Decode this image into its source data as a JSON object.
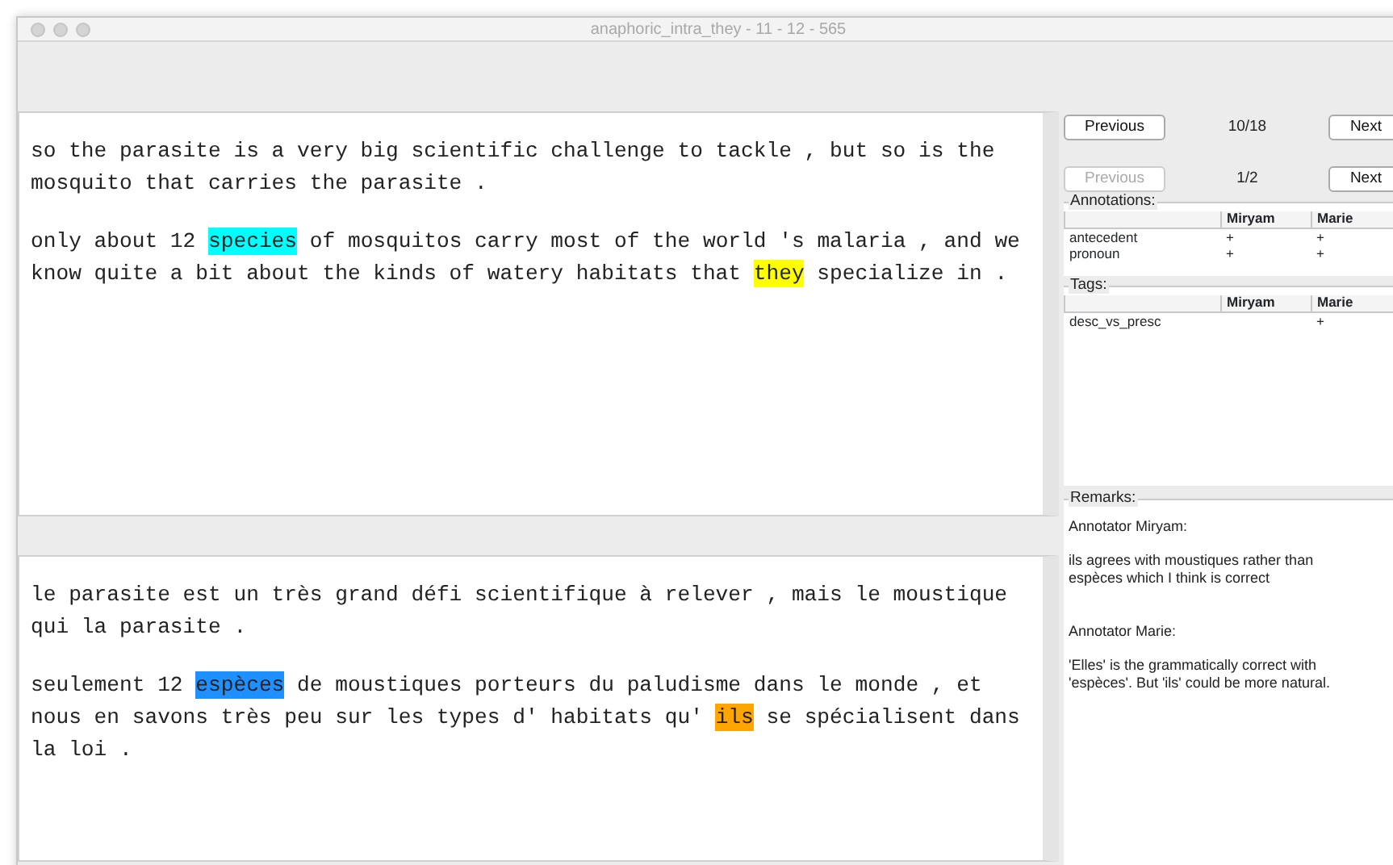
{
  "window": {
    "title": "anaphoric_intra_they - 11 - 12 - 565"
  },
  "source_text": [
    [
      {
        "text": "so the parasite is a very big scientific challenge to tackle , but so is the mosquito that carries the parasite ."
      }
    ],
    [
      {
        "text": "only about 12 "
      },
      {
        "text": "species",
        "color": "#00ffff"
      },
      {
        "text": " of mosquitos carry most of the world 's malaria , and we know quite a bit about the kinds of watery habitats that "
      },
      {
        "text": "they",
        "color": "#ffff00"
      },
      {
        "text": " specialize in ."
      }
    ]
  ],
  "target_text": [
    [
      {
        "text": "le parasite est un très grand défi scientifique à relever , mais le moustique qui la parasite ."
      }
    ],
    [
      {
        "text": "seulement 12 "
      },
      {
        "text": "espèces",
        "color": "#1e90ff"
      },
      {
        "text": " de moustiques porteurs du paludisme dans le monde , et nous en savons très peu sur les types d' habitats qu' "
      },
      {
        "text": "ils",
        "color": "#ffa500"
      },
      {
        "text": " se spécialisent dans la loi ."
      }
    ]
  ],
  "navigators": [
    {
      "previous": {
        "label": "Previous",
        "disabled": false
      },
      "counter": "10/18",
      "next": {
        "label": "Next",
        "disabled": false
      }
    },
    {
      "previous": {
        "label": "Previous",
        "disabled": true
      },
      "counter": "1/2",
      "next": {
        "label": "Next",
        "disabled": false
      }
    }
  ],
  "annotations": {
    "title": "Annotations:",
    "columns": [
      "",
      "Miryam",
      "Marie"
    ],
    "rows": [
      [
        "antecedent",
        "+",
        "+"
      ],
      [
        "pronoun",
        "+",
        "+"
      ]
    ]
  },
  "tags": {
    "title": "Tags:",
    "columns": [
      "",
      "Miryam",
      "Marie"
    ],
    "rows": [
      [
        "desc_vs_presc",
        "",
        "+"
      ]
    ]
  },
  "remarks": {
    "title": "Remarks:",
    "entries": [
      {
        "annotator": "Annotator Miryam:",
        "text": "ils agrees with moustiques rather than espèces which I think is correct"
      },
      {
        "annotator": "Annotator Marie:",
        "text": "'Elles' is the grammatically correct with 'espèces'. But 'ils' could be more natural."
      }
    ]
  }
}
